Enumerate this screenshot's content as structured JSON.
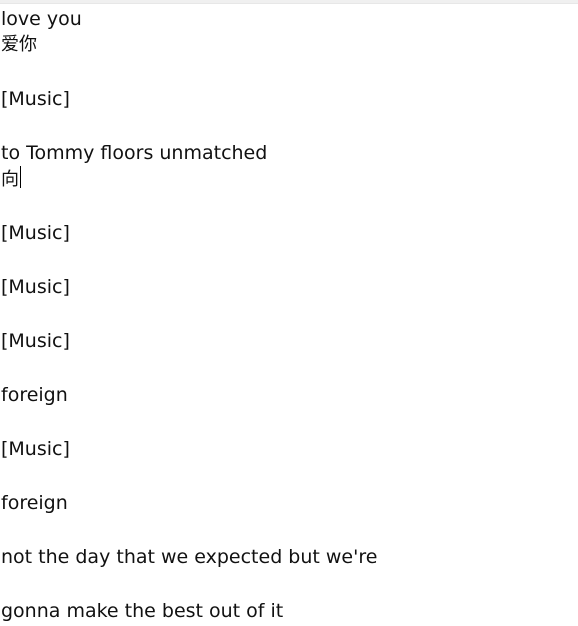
{
  "editor": {
    "lines": [
      "love you",
      "爱你",
      "[Music]",
      "to Tommy floors unmatched",
      "向",
      "[Music]",
      "[Music]",
      "[Music]",
      "foreign",
      "[Music]",
      "foreign",
      "not the day that we expected but we're",
      "gonna make the best out of it"
    ]
  }
}
